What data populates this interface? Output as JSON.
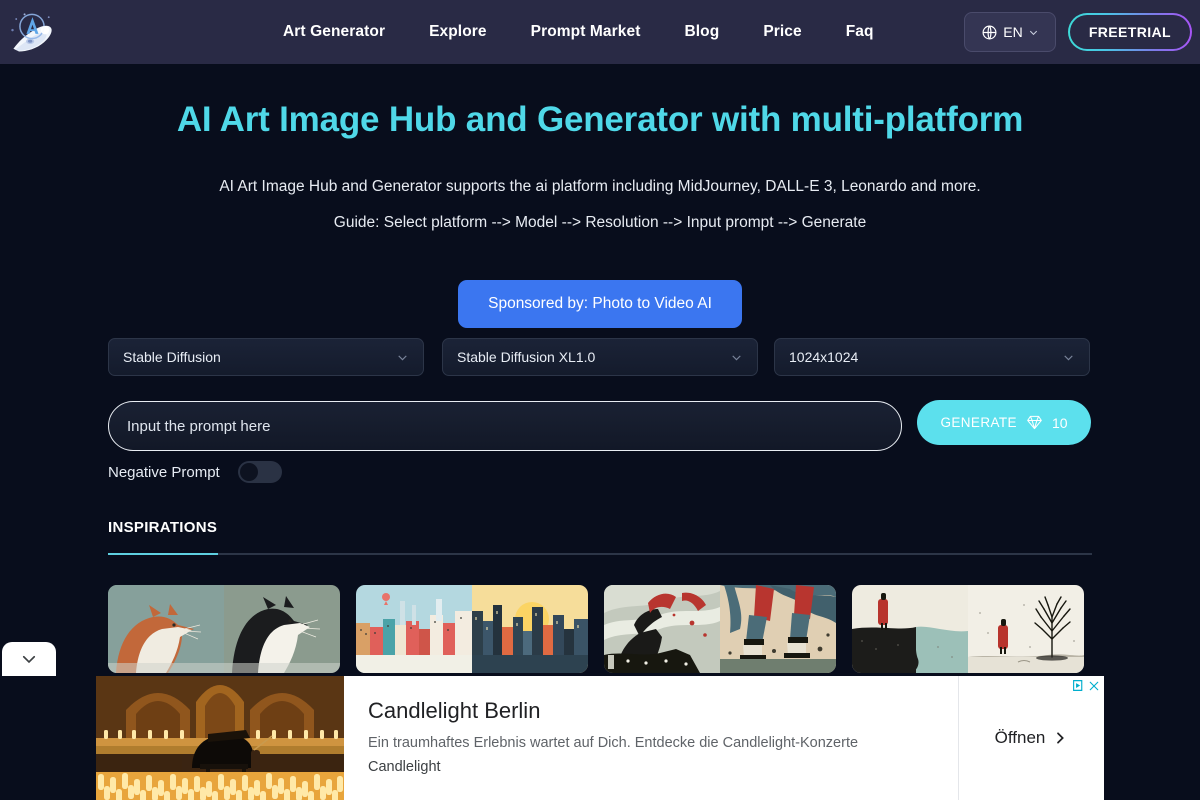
{
  "nav": {
    "logo_name": "rocket-logo",
    "links": [
      {
        "label": "Art Generator"
      },
      {
        "label": "Explore"
      },
      {
        "label": "Prompt Market"
      },
      {
        "label": "Blog"
      },
      {
        "label": "Price"
      },
      {
        "label": "Faq"
      }
    ],
    "language": {
      "label": "EN",
      "icon": "globe-icon"
    },
    "cta": {
      "label": "FREETRIAL"
    },
    "background_color": "#292a45"
  },
  "hero": {
    "title": "AI Art Image Hub and Generator with multi-platform",
    "title_color": "#4fd8e8",
    "subtitle": "AI Art Image Hub and Generator supports the ai platform including MidJourney, DALL-E 3, Leonardo and more.",
    "guide": "Guide: Select platform --> Model --> Resolution --> Input prompt --> Generate"
  },
  "sponsor": {
    "label": "Sponsored by: Photo to Video AI",
    "color": "#3b76f0"
  },
  "controls": {
    "platform": {
      "value": "Stable Diffusion"
    },
    "model": {
      "value": "Stable Diffusion XL1.0"
    },
    "resolution": {
      "value": "1024x1024"
    },
    "prompt": {
      "placeholder": "Input the prompt here",
      "value": ""
    },
    "generate": {
      "label": "GENERATE",
      "cost": "10",
      "icon": "gem-icon",
      "color": "#5ce0ed"
    },
    "negative_prompt": {
      "label": "Negative Prompt",
      "enabled": false
    }
  },
  "inspirations": {
    "title": "INSPIRATIONS",
    "accent_color": "#5ecfe0",
    "cards": [
      {
        "name": "card-cats"
      },
      {
        "name": "card-cityscapes"
      },
      {
        "name": "card-abstract-figures"
      },
      {
        "name": "card-red-coat-minimal"
      }
    ]
  },
  "collapse": {
    "icon": "chevron-down-icon"
  },
  "ad": {
    "title": "Candlelight Berlin",
    "description": "Ein traumhaftes Erlebnis wartet auf Dich. Entdecke die Candlelight-Konzerte",
    "advertiser": "Candlelight",
    "cta": "Öffnen",
    "adchoices_icon": "adchoices-icon",
    "close_icon": "close-icon",
    "image_name": "candlelight-concert-image"
  }
}
